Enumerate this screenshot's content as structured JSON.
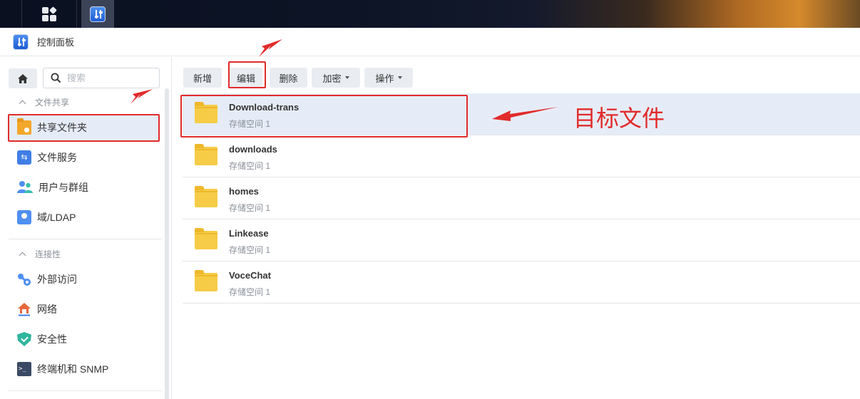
{
  "window": {
    "title": "控制面板"
  },
  "sidebar": {
    "search_placeholder": "搜索",
    "sections": [
      {
        "label": "文件共享"
      },
      {
        "label": "连接性"
      }
    ],
    "items": [
      {
        "label": "共享文件夹",
        "icon": "shared-folder-icon",
        "active": true
      },
      {
        "label": "文件服务",
        "icon": "file-services-icon"
      },
      {
        "label": "用户与群组",
        "icon": "users-groups-icon"
      },
      {
        "label": "域/LDAP",
        "icon": "domain-ldap-icon"
      },
      {
        "label": "外部访问",
        "icon": "external-access-icon"
      },
      {
        "label": "网络",
        "icon": "network-icon"
      },
      {
        "label": "安全性",
        "icon": "security-shield-icon"
      },
      {
        "label": "终端机和 SNMP",
        "icon": "terminal-icon"
      }
    ]
  },
  "toolbar": {
    "create": "新增",
    "edit": "编辑",
    "delete": "删除",
    "encrypt": "加密",
    "action": "操作"
  },
  "folders": [
    {
      "name": "Download-trans",
      "volume": "存储空间 1",
      "selected": true
    },
    {
      "name": "downloads",
      "volume": "存储空间 1"
    },
    {
      "name": "homes",
      "volume": "存储空间 1"
    },
    {
      "name": "Linkease",
      "volume": "存储空间 1"
    },
    {
      "name": "VoceChat",
      "volume": "存储空间 1"
    }
  ],
  "annotation": {
    "text": "目标文件",
    "color": "#e12b2b"
  },
  "colors": {
    "accent": "#3f7ee6",
    "selected_row": "#e6ecf7",
    "annotation_red": "#e12b2b"
  }
}
